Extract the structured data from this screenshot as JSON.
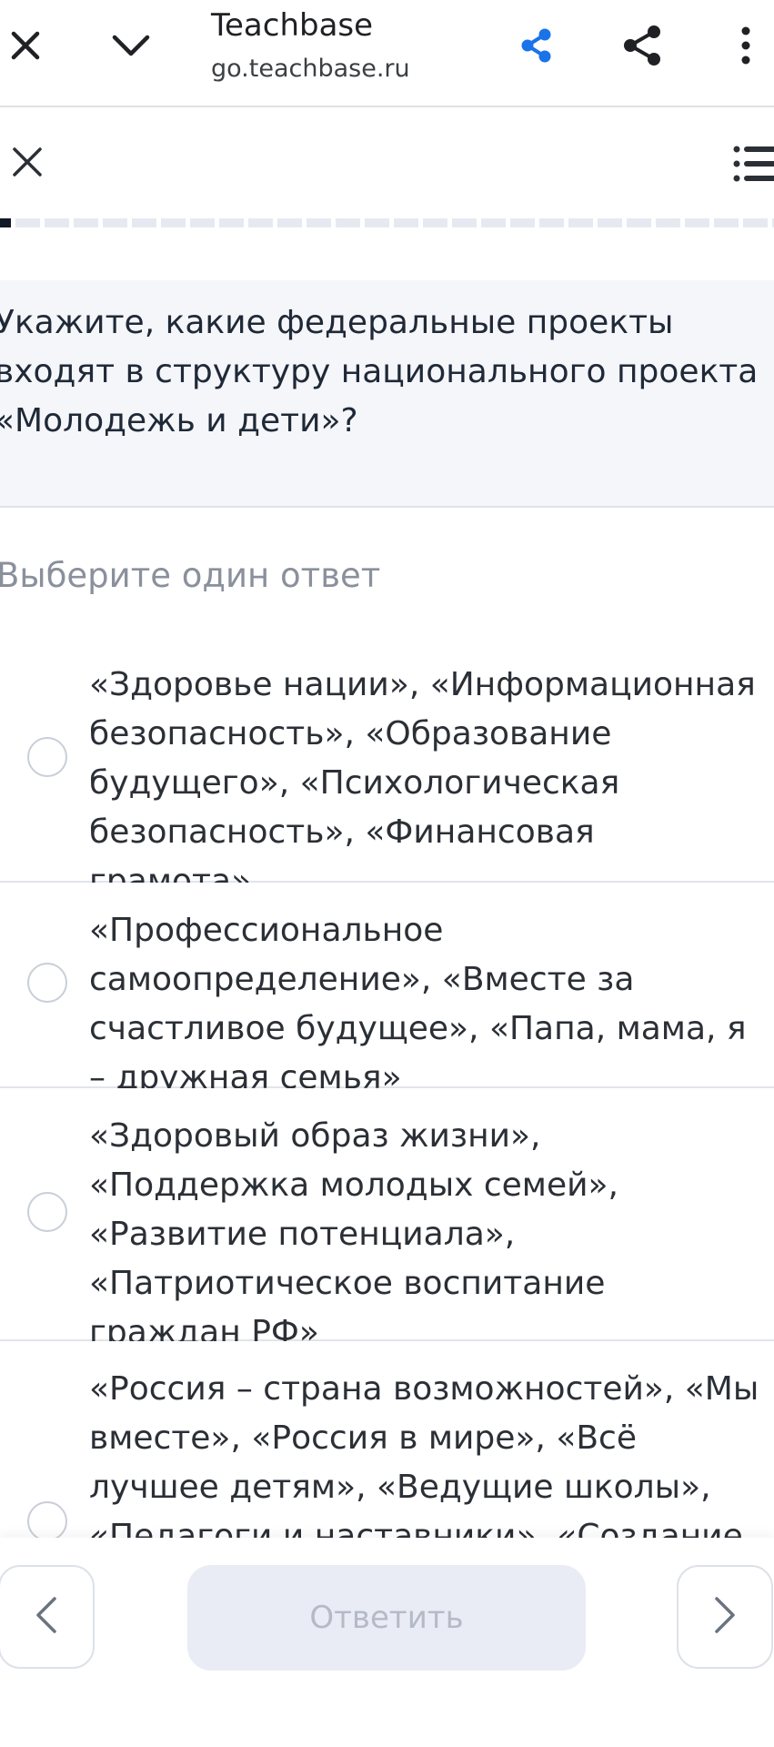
{
  "browser": {
    "title": "Teachbase",
    "url": "go.teachbase.ru",
    "icons": {
      "close": "close-icon",
      "collapse": "chevron-down-icon",
      "share_app": "share-icon",
      "share": "share-icon",
      "more": "more-vertical-icon"
    },
    "accent_color": "#1a73e8"
  },
  "quiz": {
    "header_icons": {
      "close": "close-icon",
      "contents": "list-icon"
    },
    "question": "Укажите, какие федеральные проекты входят в структуру национального проекта «Молодежь и дети»?",
    "instruction": "Выберите один ответ",
    "options": [
      {
        "label": "«Здоровье нации», «Информационная безопасность», «Образование будущего», «Психологическая безопасность», «Финансовая грамота»",
        "selected": false
      },
      {
        "label": "«Профессиональное самоопределение», «Вместе за счастливое будущее», «Папа, мама, я – дружная семья»",
        "selected": false
      },
      {
        "label": "«Здоровый образ жизни», «Поддержка молодых семей», «Развитие потенциала», «Патриотическое воспитание граждан РФ»",
        "selected": false
      },
      {
        "label": "«Россия – страна возможностей», «Мы вместе», «Россия в мире», «Всё лучшее детям», «Ведущие школы», «Педагоги и наставники», «Создание сети",
        "selected": false
      }
    ]
  },
  "footer": {
    "submit_label": "Ответить",
    "prev_icon": "chevron-left-icon",
    "next_icon": "chevron-right-icon"
  }
}
